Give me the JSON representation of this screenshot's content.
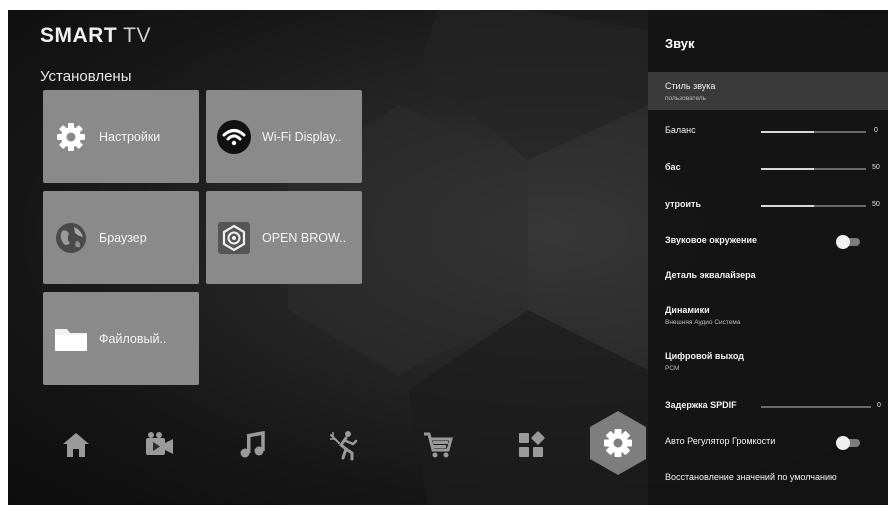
{
  "brand": {
    "bold": "SMART",
    "rest": " TV"
  },
  "apps_section_title": "Установлены",
  "apps": [
    {
      "label": "Настройки",
      "icon": "gear-icon"
    },
    {
      "label": "Wi-Fi Display..",
      "icon": "wifi-icon"
    },
    {
      "label": "Браузер",
      "icon": "globe-icon"
    },
    {
      "label": "OPEN BROW..",
      "icon": "open-browser-icon"
    },
    {
      "label": "Файловый..",
      "icon": "folder-icon"
    }
  ],
  "nav_bar": [
    "home-icon",
    "video-icon",
    "music-icon",
    "sports-icon",
    "shopping-cart-icon",
    "apps-grid-icon",
    "settings-gear-icon"
  ],
  "nav_active": "settings-gear-icon",
  "sound_panel": {
    "title": "Звук",
    "sound_style": {
      "label": "Стиль звука",
      "value": "пользователь"
    },
    "balance": {
      "label": "Баланс",
      "value": "0",
      "level": 0.5
    },
    "bass": {
      "label": "бас",
      "value": "50",
      "level": 0.5
    },
    "treble": {
      "label": "утроить",
      "value": "50",
      "level": 0.5
    },
    "surround": {
      "label": "Звуковое окружение",
      "state": "off"
    },
    "eq_detail": {
      "label": "Деталь эквалайзера"
    },
    "speakers": {
      "label": "Динамики",
      "value": "Внешняя Аудио Система"
    },
    "digital_out": {
      "label": "Цифровой выход",
      "value": "PCM"
    },
    "spdif_delay": {
      "label": "Задержка SPDIF",
      "value": "0",
      "level": 0
    },
    "auto_volume": {
      "label": "Авто Регулятор Громкости",
      "state": "off"
    },
    "restore_defaults": {
      "label": "Восстановление значений по умолчанию"
    }
  }
}
